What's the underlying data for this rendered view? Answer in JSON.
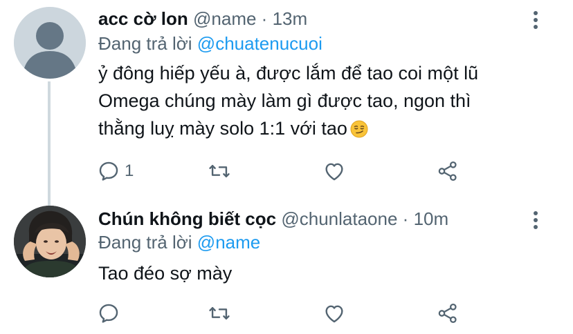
{
  "tweets": [
    {
      "author_name": "acc cờ lon",
      "handle": "@name",
      "separator": "·",
      "time": "13m",
      "replying_prefix": "Đang trả lời",
      "replying_to": "@chuatenucuoi",
      "body_lines": [
        "ỷ đông hiếp yếu à, được lắm để tao coi một lũ",
        "Omega chúng mày làm gì được tao, ngon thì",
        "thằng luỵ mày solo 1:1 với tao"
      ],
      "emoji": "smirking-face",
      "reply_count": "1"
    },
    {
      "author_name": "Chún không biết cọc",
      "handle": "@chunlataone",
      "separator": "·",
      "time": "10m",
      "replying_prefix": "Đang trả lời",
      "replying_to": "@name",
      "body_lines": [
        "Tao đéo sợ mày"
      ],
      "reply_count": ""
    }
  ],
  "icons": {
    "reply": "reply-icon",
    "retweet": "retweet-icon",
    "like": "like-icon",
    "share": "share-icon",
    "more": "more-options-icon"
  },
  "colors": {
    "text": "#0f1419",
    "secondary": "#536471",
    "link": "#1d9bf0",
    "thread_line": "#cfd9de",
    "default_avatar": "#ccd6dd"
  }
}
